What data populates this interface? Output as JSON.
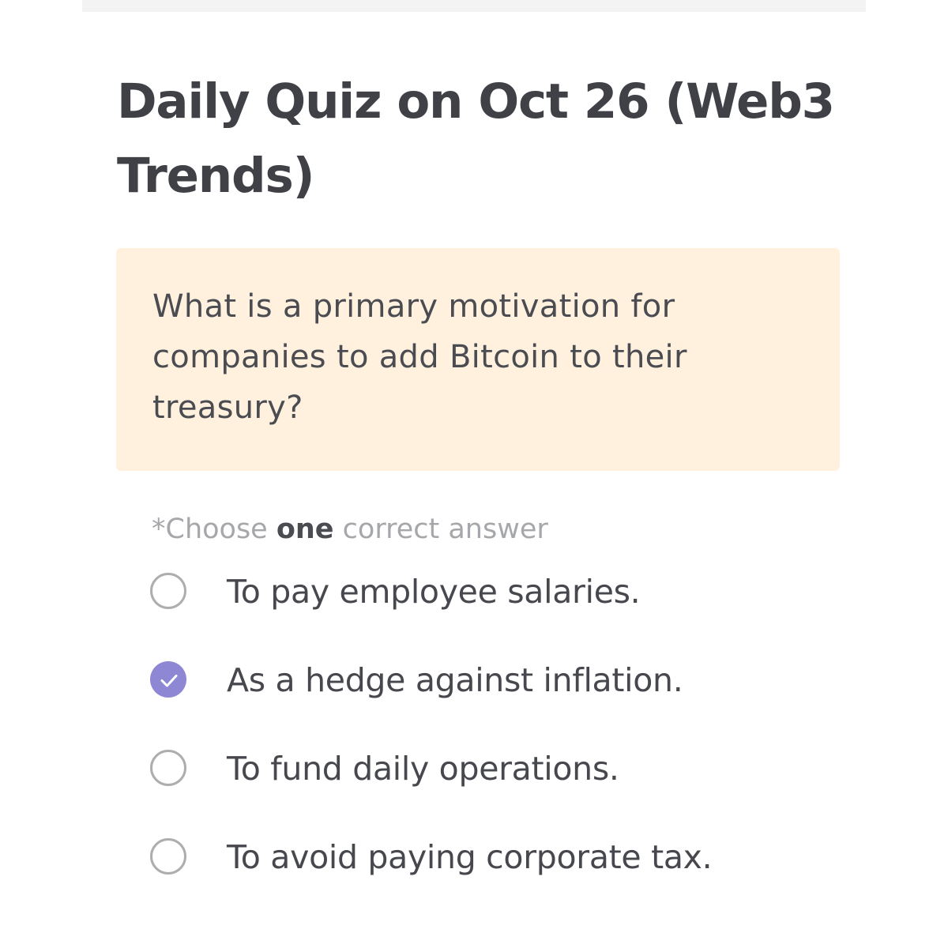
{
  "title": "Daily Quiz on Oct 26 (Web3 Trends)",
  "question": "What is a primary motivation for companies to add Bitcoin to their treasury?",
  "instruction": {
    "prefix": "*Choose ",
    "emphasis": "one",
    "suffix": " correct answer"
  },
  "options": [
    {
      "label": "To pay employee salaries.",
      "selected": false
    },
    {
      "label": "As a hedge against inflation.",
      "selected": true
    },
    {
      "label": "To fund daily operations.",
      "selected": false
    },
    {
      "label": "To avoid paying corporate tax.",
      "selected": false
    }
  ],
  "colors": {
    "card_background": "#fff1de",
    "selected_accent": "#8d87d4",
    "title_text": "#3f4147",
    "muted_text": "#a6a7aa"
  },
  "icons": {
    "selected": "check-icon",
    "unselected": "radio-empty-icon"
  }
}
